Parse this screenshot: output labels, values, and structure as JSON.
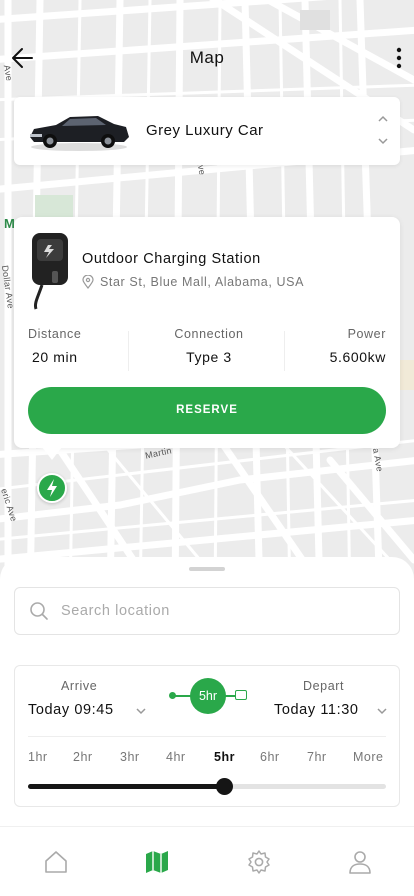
{
  "header": {
    "title": "Map",
    "back_icon": "arrow-left-icon",
    "menu_icon": "more-vertical-icon"
  },
  "map": {
    "street_labels": [
      "Ave",
      "Martin",
      "a Ave",
      "Ave",
      "eric Ave",
      "M",
      "Dollar Ave"
    ]
  },
  "vehicle": {
    "name": "Grey Luxury Car",
    "stepper_icon": "chevron-up-down-icon"
  },
  "station": {
    "name": "Outdoor Charging Station",
    "address": "Star St, Blue Mall, Alabama, USA",
    "location_icon": "map-pin-icon",
    "stats": {
      "distance_label": "Distance",
      "distance_value": "20 min",
      "connection_label": "Connection",
      "connection_value": "Type 3",
      "power_label": "Power",
      "power_value": "5.600kw"
    },
    "reserve_label": "RESERVE"
  },
  "search": {
    "placeholder": "Search location",
    "value": ""
  },
  "schedule": {
    "arrive_label": "Arrive",
    "arrive_value": "Today 09:45",
    "depart_label": "Depart",
    "depart_value": "Today 11:30",
    "duration": "5hr",
    "hour_options": [
      "1hr",
      "2hr",
      "3hr",
      "4hr",
      "5hr",
      "6hr",
      "7hr",
      "More"
    ],
    "selected_index": 4,
    "slider_fraction": 0.55
  },
  "tabbar": {
    "items": [
      {
        "icon": "home-icon",
        "active": false
      },
      {
        "icon": "map-icon",
        "active": true
      },
      {
        "icon": "settings-icon",
        "active": false
      },
      {
        "icon": "profile-icon",
        "active": false
      }
    ]
  },
  "colors": {
    "accent": "#2aa84a",
    "map_bg": "#ececec",
    "text_dark": "#111111",
    "text_muted": "#777777"
  }
}
